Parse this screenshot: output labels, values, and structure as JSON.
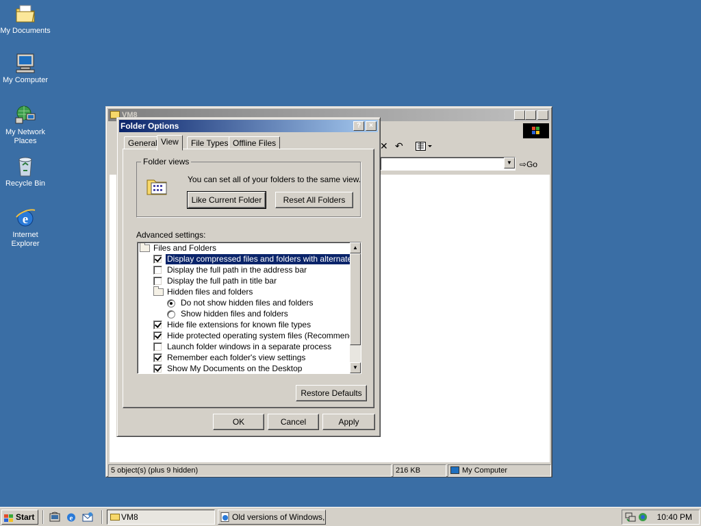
{
  "desktop": {
    "icons": [
      {
        "label": "My Documents",
        "icon": "folder-documents-icon"
      },
      {
        "label": "My Computer",
        "icon": "computer-icon"
      },
      {
        "label": "My Network Places",
        "icon": "network-icon"
      },
      {
        "label": "Recycle Bin",
        "icon": "recycle-bin-icon"
      },
      {
        "label": "Internet Explorer",
        "icon": "ie-icon"
      }
    ]
  },
  "explorer": {
    "title": "VM8",
    "go_label": "Go",
    "status": {
      "objects": "5 object(s) (plus 9 hidden)",
      "size": "216 KB",
      "zone": "My Computer"
    }
  },
  "dialog": {
    "title": "Folder Options",
    "help": "?",
    "close": "×",
    "tabs": [
      "General",
      "View",
      "File Types",
      "Offline Files"
    ],
    "active_tab": "View",
    "folder_views": {
      "legend": "Folder views",
      "text": "You can set all of your folders to the same view.",
      "like_current": "Like Current Folder",
      "reset_all": "Reset All Folders"
    },
    "advanced_label": "Advanced settings:",
    "advanced_items": [
      {
        "kind": "folder",
        "label": "Files and Folders",
        "level": 0
      },
      {
        "kind": "checkbox",
        "label": "Display compressed files and folders with alternate color",
        "checked": true,
        "level": 1,
        "selected": true
      },
      {
        "kind": "checkbox",
        "label": "Display the full path in the address bar",
        "checked": false,
        "level": 1
      },
      {
        "kind": "checkbox",
        "label": "Display the full path in title bar",
        "checked": false,
        "level": 1
      },
      {
        "kind": "folder",
        "label": "Hidden files and folders",
        "level": 1
      },
      {
        "kind": "radio",
        "label": "Do not show hidden files and folders",
        "checked": true,
        "level": 2
      },
      {
        "kind": "radio",
        "label": "Show hidden files and folders",
        "checked": false,
        "level": 2
      },
      {
        "kind": "checkbox",
        "label": "Hide file extensions for known file types",
        "checked": true,
        "level": 1
      },
      {
        "kind": "checkbox",
        "label": "Hide protected operating system files (Recommended)",
        "checked": true,
        "level": 1
      },
      {
        "kind": "checkbox",
        "label": "Launch folder windows in a separate process",
        "checked": false,
        "level": 1
      },
      {
        "kind": "checkbox",
        "label": "Remember each folder's view settings",
        "checked": true,
        "level": 1
      },
      {
        "kind": "checkbox",
        "label": "Show My Documents on the Desktop",
        "checked": true,
        "level": 1
      }
    ],
    "restore_defaults": "Restore Defaults",
    "ok": "OK",
    "cancel": "Cancel",
    "apply": "Apply"
  },
  "taskbar": {
    "start": "Start",
    "tasks": [
      {
        "label": "VM8",
        "pressed": true
      },
      {
        "label": "Old versions of Windows,...",
        "pressed": false
      }
    ],
    "clock": "10:40 PM"
  }
}
